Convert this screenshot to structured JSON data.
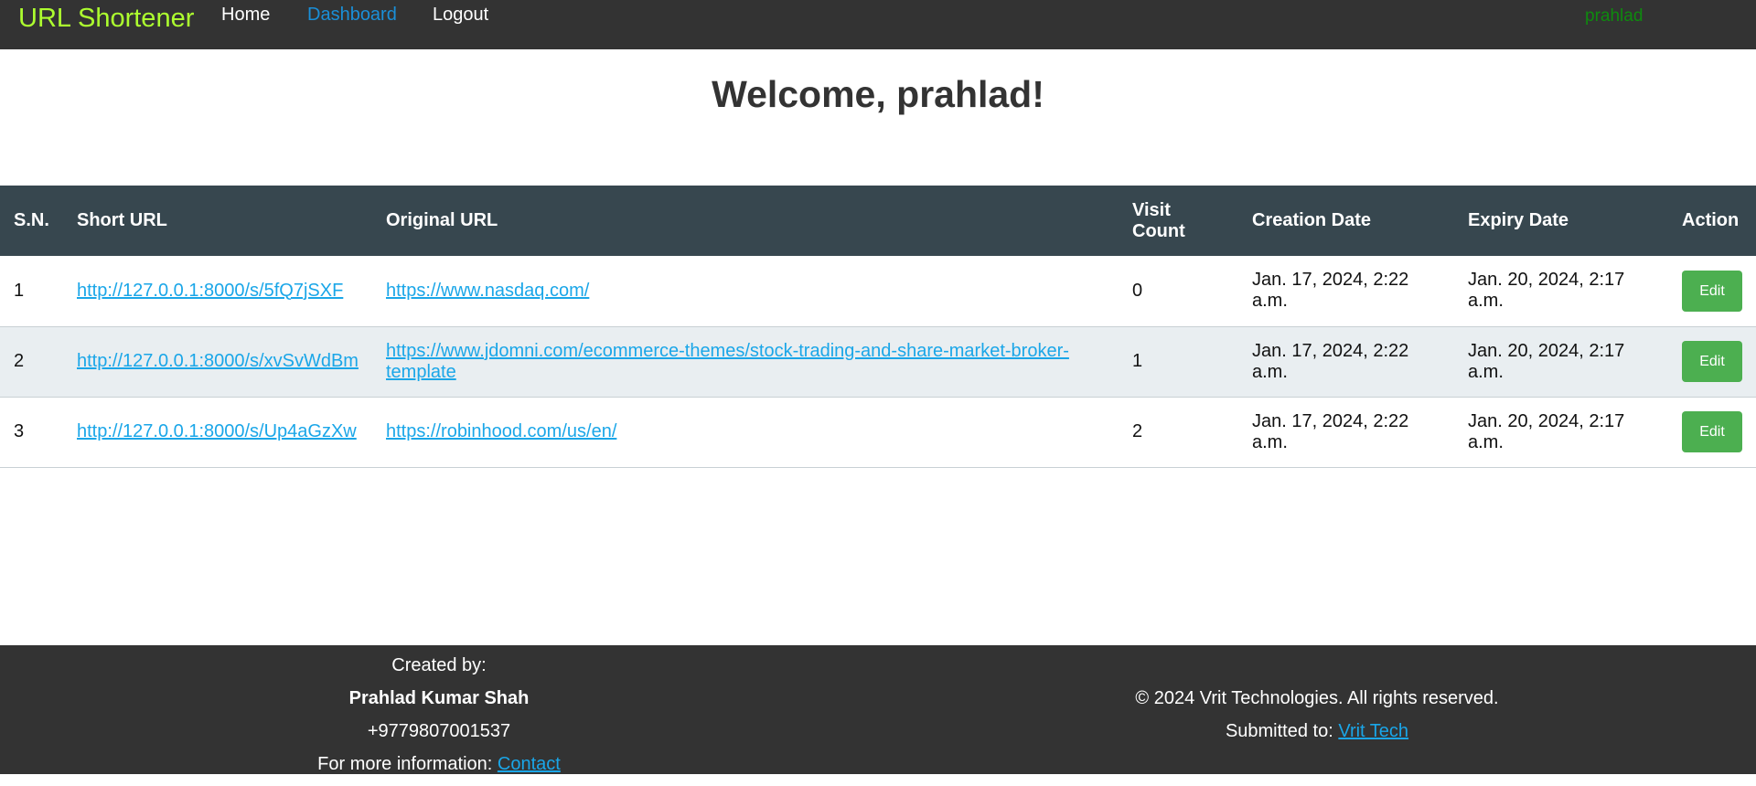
{
  "nav": {
    "brand": "URL Shortener",
    "home": "Home",
    "dashboard": "Dashboard",
    "logout": "Logout",
    "username": "prahlad"
  },
  "welcome": "Welcome, prahlad!",
  "table": {
    "headers": {
      "sn": "S.N.",
      "short_url": "Short URL",
      "original_url": "Original URL",
      "visit_count_1": "Visit",
      "visit_count_2": "Count",
      "creation_date": "Creation Date",
      "expiry_date": "Expiry Date",
      "action": "Action"
    },
    "rows": [
      {
        "sn": "1",
        "short_url": "http://127.0.0.1:8000/s/5fQ7jSXF",
        "original_url": "https://www.nasdaq.com/",
        "visit_count": "0",
        "creation_date": "Jan. 17, 2024, 2:22 a.m.",
        "expiry_date": "Jan. 20, 2024, 2:17 a.m.",
        "action": "Edit"
      },
      {
        "sn": "2",
        "short_url": "http://127.0.0.1:8000/s/xvSvWdBm",
        "original_url": "https://www.jdomni.com/ecommerce-themes/stock-trading-and-share-market-broker-template",
        "visit_count": "1",
        "creation_date": "Jan. 17, 2024, 2:22 a.m.",
        "expiry_date": "Jan. 20, 2024, 2:17 a.m.",
        "action": "Edit"
      },
      {
        "sn": "3",
        "short_url": "http://127.0.0.1:8000/s/Up4aGzXw",
        "original_url": "https://robinhood.com/us/en/",
        "visit_count": "2",
        "creation_date": "Jan. 17, 2024, 2:22 a.m.",
        "expiry_date": "Jan. 20, 2024, 2:17 a.m.",
        "action": "Edit"
      }
    ]
  },
  "footer": {
    "created_by": "Created by:",
    "author": "Prahlad Kumar Shah",
    "phone": "+9779807001537",
    "more_info": "For more information:",
    "contact_link": "Contact",
    "copyright": "© 2024 Vrit Technologies. All rights reserved.",
    "submitted_to": "Submitted to:",
    "submitted_link": "Vrit Tech"
  },
  "colors": {
    "navbar_bg": "#333333",
    "brand": "#adff2f",
    "table_header_bg": "#37474f",
    "link": "#1aa6e8",
    "edit_button": "#4caf50"
  }
}
